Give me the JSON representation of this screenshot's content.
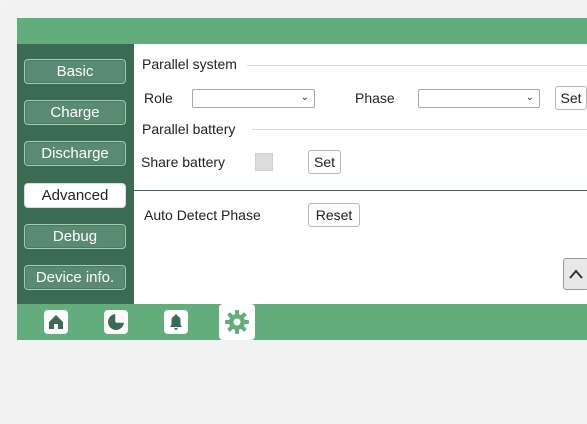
{
  "nav": {
    "items": [
      {
        "label": "Basic"
      },
      {
        "label": "Charge"
      },
      {
        "label": "Discharge"
      },
      {
        "label": "Advanced"
      },
      {
        "label": "Debug"
      },
      {
        "label": "Device info."
      }
    ],
    "active": "Advanced"
  },
  "parallel_system": {
    "title": "Parallel system",
    "role_label": "Role",
    "role_value": "",
    "phase_label": "Phase",
    "phase_value": "",
    "set_label": "Set"
  },
  "parallel_battery": {
    "title": "Parallel battery",
    "share_label": "Share battery",
    "share_checked": false,
    "set_label": "Set"
  },
  "auto_detect": {
    "label": "Auto Detect Phase",
    "reset_label": "Reset"
  },
  "bottom_tabs": [
    {
      "icon": "home-icon"
    },
    {
      "icon": "pie-chart-icon"
    },
    {
      "icon": "bell-icon"
    },
    {
      "icon": "gear-icon",
      "active": true
    }
  ],
  "colors": {
    "bar_green": "#63ad7d",
    "sidebar_green": "#3c6b54",
    "nav_button": "#5b8a73",
    "icon_white": "#ffffff"
  }
}
